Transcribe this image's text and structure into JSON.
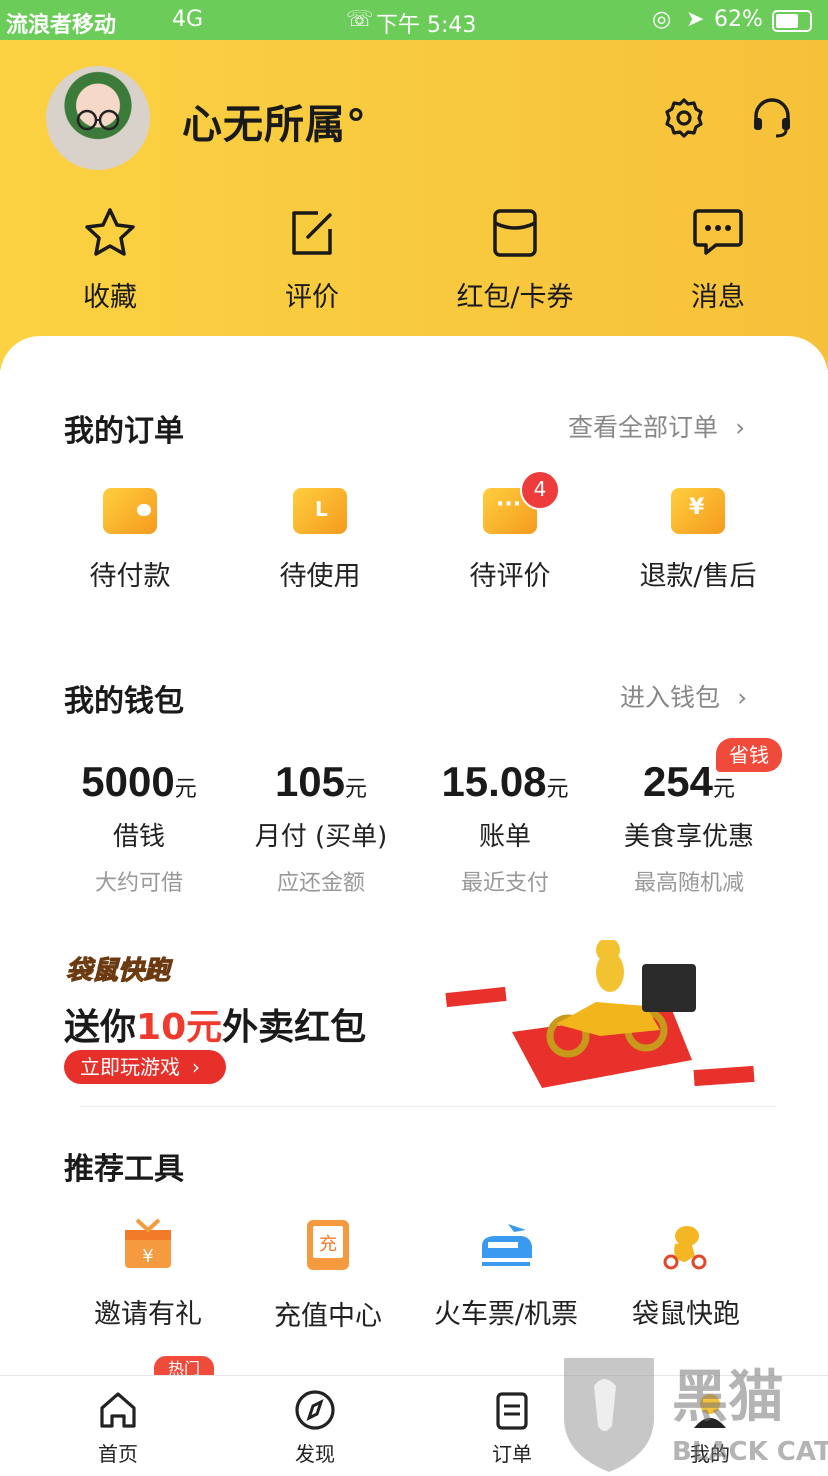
{
  "status_bar": {
    "carrier": "流浪者移动",
    "network": "4G",
    "time": "下午 5:43",
    "battery": "62%"
  },
  "profile": {
    "username": "心无所属°"
  },
  "quick_actions": [
    {
      "label": "收藏",
      "icon": "star-icon"
    },
    {
      "label": "评价",
      "icon": "edit-icon"
    },
    {
      "label": "红包/卡券",
      "icon": "coupon-icon"
    },
    {
      "label": "消息",
      "icon": "message-icon"
    }
  ],
  "orders": {
    "title": "我的订单",
    "link": "查看全部订单",
    "items": [
      {
        "label": "待付款",
        "icon": "wallet-icon"
      },
      {
        "label": "待使用",
        "icon": "ticket-icon"
      },
      {
        "label": "待评价",
        "icon": "comment-icon",
        "badge": "4"
      },
      {
        "label": "退款/售后",
        "icon": "refund-icon"
      }
    ]
  },
  "wallet": {
    "title": "我的钱包",
    "link": "进入钱包",
    "unit": "元",
    "save_badge": "省钱",
    "items": [
      {
        "amount": "5000",
        "label": "借钱",
        "sub": "大约可借"
      },
      {
        "amount": "105",
        "label": "月付 (买单)",
        "sub": "应还金额"
      },
      {
        "amount": "15.08",
        "label": "账单",
        "sub": "最近支付"
      },
      {
        "amount": "254",
        "label": "美食享优惠",
        "sub": "最高随机减"
      }
    ]
  },
  "banner": {
    "logo": "袋鼠快跑",
    "text_prefix": "送你",
    "text_highlight": "10元",
    "text_suffix": "外卖红包",
    "button": "立即玩游戏"
  },
  "tools": {
    "title": "推荐工具",
    "hot_badge": "热门",
    "items": [
      {
        "label": "邀请有礼",
        "icon": "gift-icon"
      },
      {
        "label": "充值中心",
        "icon": "recharge-icon"
      },
      {
        "label": "火车票/机票",
        "icon": "train-icon"
      },
      {
        "label": "袋鼠快跑",
        "icon": "kangaroo-icon"
      }
    ]
  },
  "tab_bar": [
    {
      "label": "首页",
      "icon": "home-icon"
    },
    {
      "label": "发现",
      "icon": "compass-icon"
    },
    {
      "label": "订单",
      "icon": "orders-icon"
    },
    {
      "label": "我的",
      "icon": "profile-icon",
      "active": true
    }
  ],
  "watermark": "BLACK CAT 黑猫",
  "colors": {
    "header": "#f6c13a",
    "accent_red": "#ee3b2d",
    "status_bar": "#6ccc5a"
  }
}
